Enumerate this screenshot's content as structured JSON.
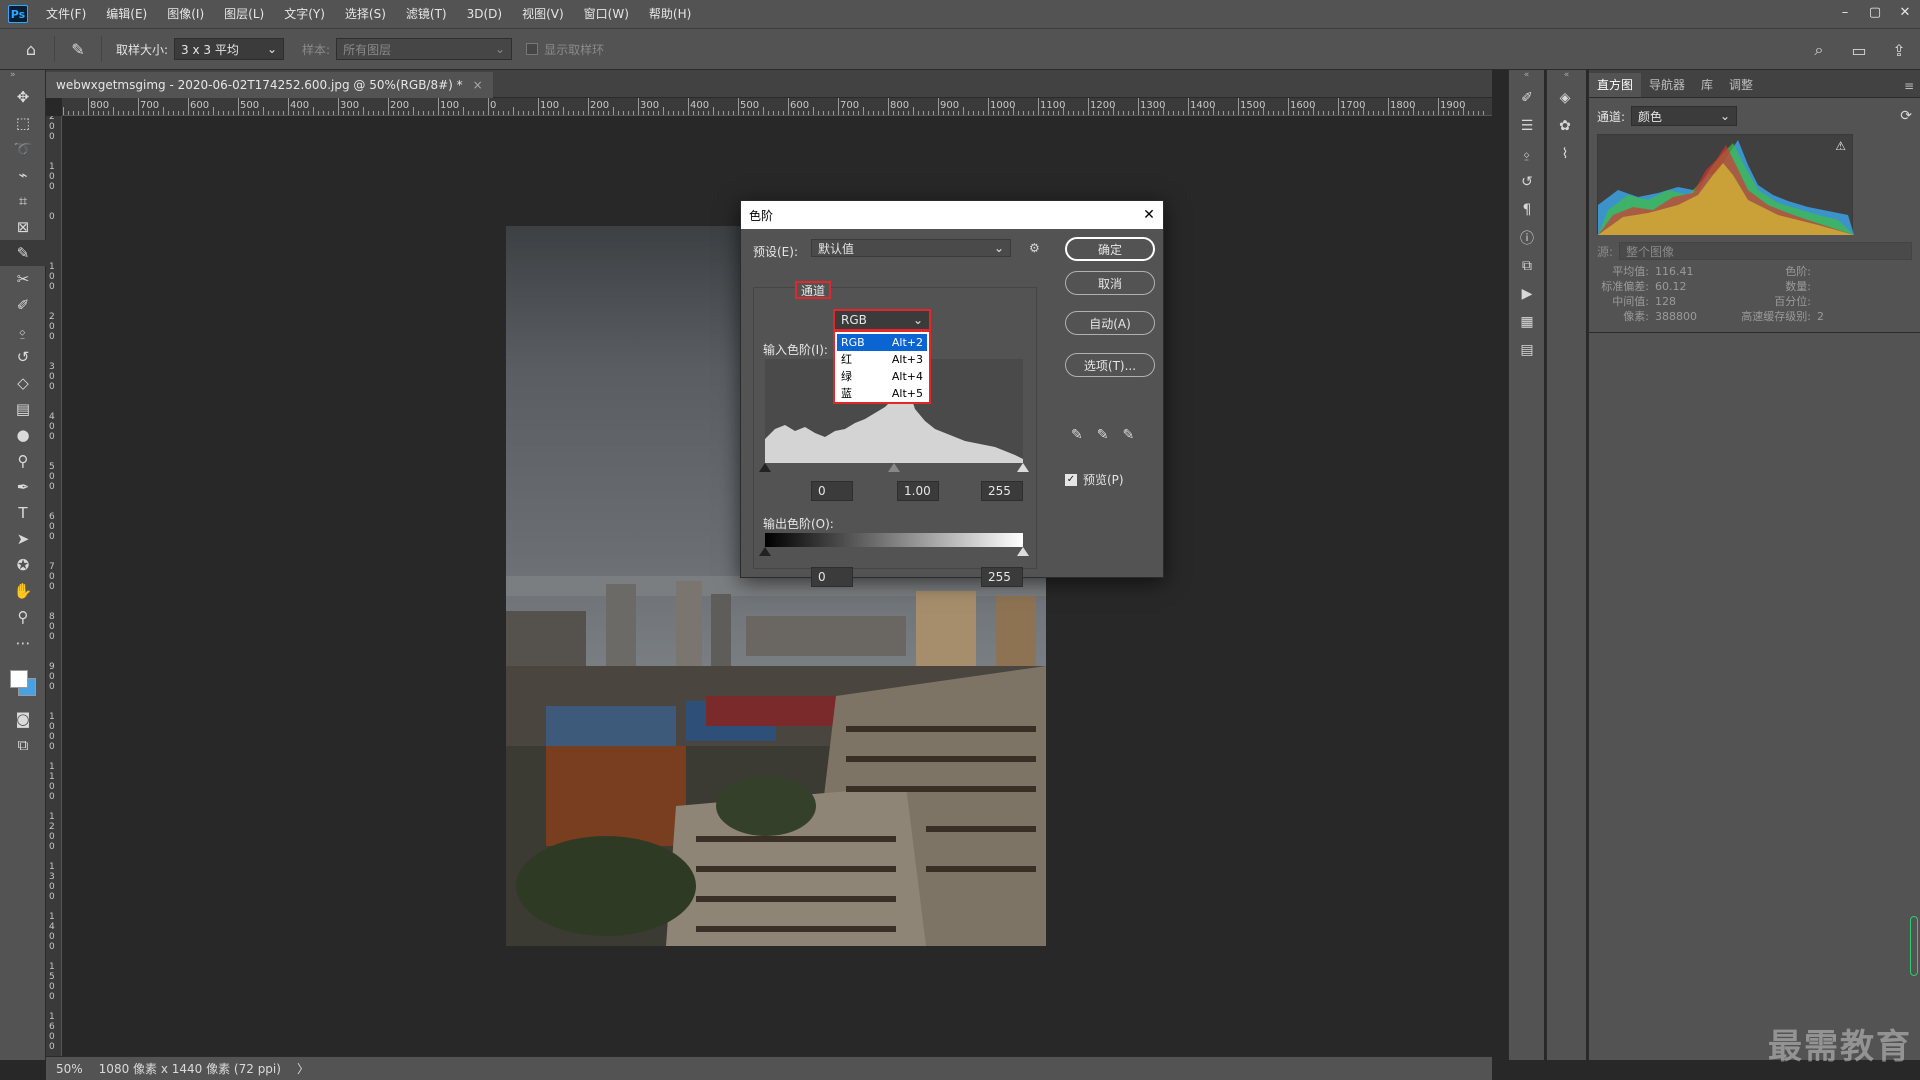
{
  "app": {
    "logo": "Ps"
  },
  "menu": [
    "文件(F)",
    "编辑(E)",
    "图像(I)",
    "图层(L)",
    "文字(Y)",
    "选择(S)",
    "滤镜(T)",
    "3D(D)",
    "视图(V)",
    "窗口(W)",
    "帮助(H)"
  ],
  "window_controls": {
    "minimize": "–",
    "restore": "▢",
    "close": "✕"
  },
  "options": {
    "sample_size_label": "取样大小:",
    "sample_size_value": "3 x 3 平均",
    "sample_label": "样本:",
    "sample_value": "所有图层",
    "show_ring_label": "显示取样环"
  },
  "document": {
    "tab_title": "webwxgetmsgimg - 2020-06-02T174252.600.jpg @ 50%(RGB/8#) *",
    "tab_close": "×",
    "ruler_h": [
      "900",
      "800",
      "700",
      "600",
      "500",
      "400",
      "300",
      "200",
      "100",
      "0",
      "100",
      "200",
      "300",
      "400",
      "500",
      "600",
      "700",
      "800",
      "900",
      "1000",
      "1100",
      "1200",
      "1300",
      "1400",
      "1500",
      "1600",
      "1700",
      "1800",
      "1900"
    ],
    "ruler_v": [
      "200",
      "100",
      "0",
      "100",
      "200",
      "300",
      "400",
      "500",
      "600",
      "700",
      "800",
      "900",
      "1000",
      "1100",
      "1200",
      "1300",
      "1400",
      "1500",
      "1600",
      "1700"
    ],
    "status_zoom": "50%",
    "status_info": "1080 像素 x 1440 像素 (72 ppi)"
  },
  "panel": {
    "tabs": [
      "直方图",
      "导航器",
      "库",
      "调整"
    ],
    "channel_label": "通道:",
    "channel_value": "颜色",
    "source_label": "源:",
    "source_value": "整个图像",
    "stats": [
      {
        "k": "平均值:",
        "v": "116.41",
        "k2": "色阶:",
        "v2": ""
      },
      {
        "k": "标准偏差:",
        "v": "60.12",
        "k2": "数量:",
        "v2": ""
      },
      {
        "k": "中间值:",
        "v": "128",
        "k2": "百分位:",
        "v2": ""
      },
      {
        "k": "像素:",
        "v": "388800",
        "k2": "高速缓存级别:",
        "v2": "2"
      }
    ]
  },
  "dialog": {
    "title": "色阶",
    "preset_label": "预设(E):",
    "preset_value": "默认值",
    "channel_label": "通道",
    "channel_value": "RGB",
    "channel_options": [
      {
        "name": "RGB",
        "shortcut": "Alt+2"
      },
      {
        "name": "红",
        "shortcut": "Alt+3"
      },
      {
        "name": "绿",
        "shortcut": "Alt+4"
      },
      {
        "name": "蓝",
        "shortcut": "Alt+5"
      }
    ],
    "input_label": "输入色阶(I):",
    "input_black": "0",
    "input_gamma": "1.00",
    "input_white": "255",
    "output_label": "输出色阶(O):",
    "output_black": "0",
    "output_white": "255",
    "ok": "确定",
    "cancel": "取消",
    "auto": "自动(A)",
    "options": "选项(T)...",
    "preview": "预览(P)"
  },
  "watermark": "最需教育"
}
